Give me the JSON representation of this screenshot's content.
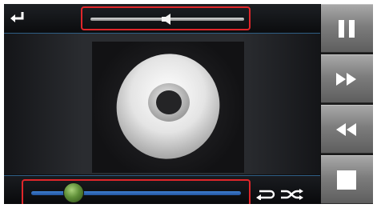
{
  "player": {
    "volume_level": 0.5,
    "seek_position": 0.2
  },
  "icons": {
    "back": "back-arrow-icon",
    "volume": "speaker-icon",
    "repeat": "repeat-icon",
    "shuffle": "shuffle-icon",
    "pause": "pause-icon",
    "fast_forward": "fast-forward-icon",
    "rewind": "rewind-icon",
    "stop": "stop-icon"
  },
  "colors": {
    "highlight_border": "#e0262a",
    "seek_track": "#3e7fd0",
    "seek_thumb": "#6fa043",
    "side_button": "#8a8a8a"
  }
}
